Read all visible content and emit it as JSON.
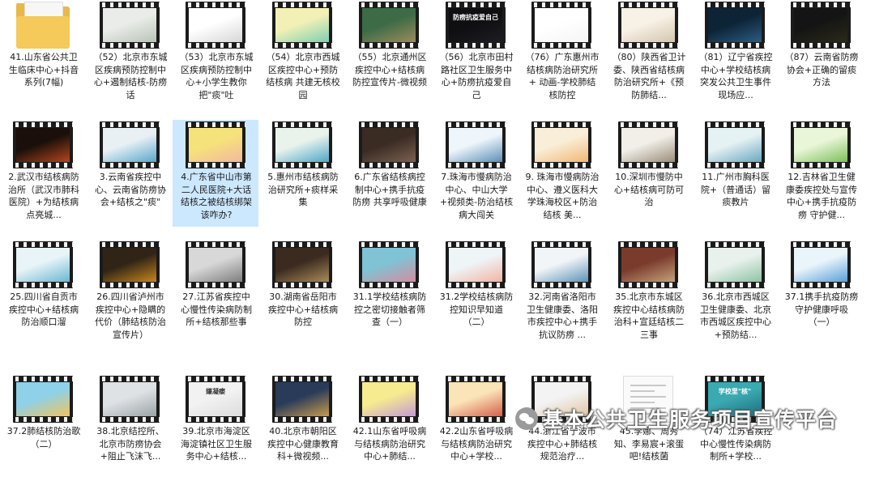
{
  "tiles": [
    {
      "label": "41.山东省公共卫生临床中心+抖音系列(7幅)",
      "kind": "folder"
    },
    {
      "label": "（52）北京市东城区疾病预防控制中心+遏制结核-防痨话",
      "kind": "video",
      "palette": [
        "#e9ece8",
        "#b9c4b8"
      ]
    },
    {
      "label": "（53）北京市东城区疾病预防控制中心+小学生教你把\"痰\"吐",
      "kind": "video",
      "palette": [
        "#ffffff",
        "#d7d7d7"
      ]
    },
    {
      "label": "（54）北京市西城区疾控中心+预防结核病 共建无核校园",
      "kind": "video",
      "palette": [
        "#f3f0b6",
        "#7fd0b1"
      ]
    },
    {
      "label": "（55）北京通州区疾控中心+结核病防控宣传片-微视频",
      "kind": "video",
      "palette": [
        "#3c6b46",
        "#9c8b5d"
      ]
    },
    {
      "label": "（56）北京市田村路社区卫生服务中心+防痨抗疫爱自己",
      "kind": "video",
      "palette": [
        "#0f0f12",
        "#1c1c22"
      ],
      "caption": "防痨抗疫爱自己"
    },
    {
      "label": "（76）广东惠州市结核病防治研究所+ 动画-学校肺结核防控",
      "kind": "video",
      "palette": [
        "#ffffff",
        "#f5f5f5"
      ]
    },
    {
      "label": "（80）陕西省卫计委、陕西省结核病防治研究所+《预防肺结...",
      "kind": "video",
      "palette": [
        "#f7f1e6",
        "#d6c5ad"
      ]
    },
    {
      "label": "（81）辽宁省疾控中心+学校结核病突发公共卫生事件现场应...",
      "kind": "video",
      "palette": [
        "#0d2336",
        "#2b5c82"
      ]
    },
    {
      "label": "（87）云南省防痨协会+正确的留痰方法",
      "kind": "video",
      "palette": [
        "#141414",
        "#2a2a1a"
      ]
    },
    {
      "label": "2.武汉市结核病防治所（武汉市肺科医院）+为结核病点亮城...",
      "kind": "video",
      "palette": [
        "#1a0f0a",
        "#b4461f"
      ]
    },
    {
      "label": "3.云南省疾控中心、云南省防痨协会+结核之\"痰\"",
      "kind": "video",
      "palette": [
        "#e8f0f4",
        "#59a7c9"
      ]
    },
    {
      "label": "4.广东省中山市第二人民医院+大话结核之被结核绑架该咋办?",
      "kind": "video",
      "palette": [
        "#f6e27a",
        "#f2b8a0"
      ],
      "selected": true
    },
    {
      "label": "5.惠州市结核病防治研究所+痰样采集",
      "kind": "video",
      "palette": [
        "#e9f3ec",
        "#4fa7c7"
      ]
    },
    {
      "label": "6.广东省结核病控制中心+携手抗疫防痨 共享呼吸健康",
      "kind": "video",
      "palette": [
        "#3a2b23",
        "#7b6151"
      ]
    },
    {
      "label": "7.珠海市慢病防治中心、中山大学+视频类-防治结核病大闯关",
      "kind": "video",
      "palette": [
        "#eef6fb",
        "#5c8fb6"
      ]
    },
    {
      "label": "9. 珠海市慢病防治中心、遵义医科大学珠海校区+防治结核 美...",
      "kind": "video",
      "palette": [
        "#f9eed7",
        "#f1b774"
      ]
    },
    {
      "label": "10.深圳市慢防中心+结核病可防可治",
      "kind": "video",
      "palette": [
        "#f1efe8",
        "#9c8d7a"
      ]
    },
    {
      "label": "11.广州市胸科医院+（普通话）留痰教片",
      "kind": "video",
      "palette": [
        "#e5f2f3",
        "#6aa8c0"
      ]
    },
    {
      "label": "12.吉林省卫生健康委疾控处与宣传中心+携手抗疫防痨 守护健...",
      "kind": "video",
      "palette": [
        "#eaf6d8",
        "#7cbf5b"
      ]
    },
    {
      "label": "25.四川省自贡市疾控中心+结核病防治顺口溜",
      "kind": "video",
      "palette": [
        "#e9f4f8",
        "#6ab7d2"
      ]
    },
    {
      "label": "26.四川省泸州市疾控中心+隐瞒的代价（肺结核防治宣传片）",
      "kind": "video",
      "palette": [
        "#2f2416",
        "#c8861d"
      ]
    },
    {
      "label": "27.江苏省疾控中心慢性传染病防制所+结核那些事",
      "kind": "video",
      "palette": [
        "#d8d8d8",
        "#7e7e7e"
      ]
    },
    {
      "label": "30.湖南省岳阳市疾控中心+结核病防控",
      "kind": "video",
      "palette": [
        "#3b2a1f",
        "#a88b5a"
      ]
    },
    {
      "label": "31.1学校结核病防控之密切接触者筛查（一）",
      "kind": "video",
      "palette": [
        "#7fc3d4",
        "#d48e9e"
      ]
    },
    {
      "label": "31.2学校结核病防控知识早知道（二）",
      "kind": "video",
      "palette": [
        "#eef5f7",
        "#f3b3a4"
      ]
    },
    {
      "label": "32.河南省洛阳市卫生健康委、洛阳市疾控中心+携手抗议防痨 ...",
      "kind": "video",
      "palette": [
        "#f2f5f7",
        "#5f93b8"
      ]
    },
    {
      "label": "35.北京市东城区疾控中心结核病防治科+宣廷结核二三事",
      "kind": "video",
      "palette": [
        "#7a3b2d",
        "#c4a27a"
      ]
    },
    {
      "label": "36.北京市西城区卫生健康委、北京市西城区疾控中心+预防结...",
      "kind": "video",
      "palette": [
        "#e8f1ec",
        "#8ec3a4"
      ]
    },
    {
      "label": "37.1携手抗疫防痨守护健康呼吸（一）",
      "kind": "video",
      "palette": [
        "#eaf4fb",
        "#5aa0d8"
      ]
    },
    {
      "label": "37.2肺结核防治歌（二）",
      "kind": "video",
      "palette": [
        "#8ed1e8",
        "#f1c45c"
      ]
    },
    {
      "label": "38.北京结控所、北京市防痨协会+阻止飞沫飞...",
      "kind": "video",
      "palette": [
        "#dfe2e4",
        "#9aa3a8"
      ]
    },
    {
      "label": "39.北京市海淀区海淀镇社区卫生服务中心+结核...",
      "kind": "video",
      "palette": [
        "#f2f2f2",
        "#dcdcdc"
      ],
      "caption": "嫌凝瘘",
      "captionColor": "#333"
    },
    {
      "label": "40.北京市朝阳区疾控中心健康教育科+微视频...",
      "kind": "video",
      "palette": [
        "#2a3b5a",
        "#c69b4a"
      ]
    },
    {
      "label": "42.1山东省呼吸病与结核病防治研究中心+肺结...",
      "kind": "video",
      "palette": [
        "#f7eb8f",
        "#c39bd3"
      ]
    },
    {
      "label": "42.2山东省呼吸病与结核病防治研究中心+学校...",
      "kind": "video",
      "palette": [
        "#fbe4b8",
        "#d5604a"
      ]
    },
    {
      "label": "44.浙江省宁波市疾控中心+肺结核规范治疗...",
      "kind": "video",
      "palette": [
        "#f3f3f3",
        "#e2c5a0"
      ]
    },
    {
      "label": "45.李娜、周秀知、李易宸+滚蛋吧!结核菌",
      "kind": "doc"
    },
    {
      "label": "（74）江苏省疾控中心慢性传染病防制所+学校...",
      "kind": "video",
      "palette": [
        "#3aa9b2",
        "#1f6e7a"
      ],
      "caption": "学校里\"核\"",
      "captionColor": "#ffffff"
    }
  ],
  "watermark": {
    "text": "基本公共卫生服务项目宣传平台",
    "icon": "wechat-icon"
  }
}
